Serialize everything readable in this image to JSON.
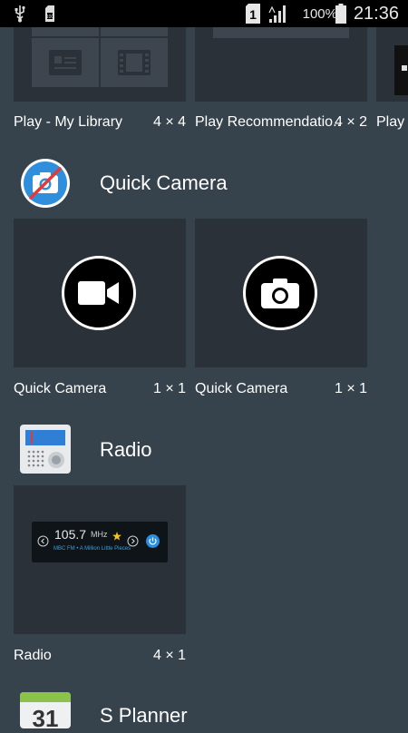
{
  "status_bar": {
    "battery_percent": "100%",
    "time": "21:36",
    "sim_slot": "1",
    "icons": [
      "usb-icon",
      "sd-card-icon",
      "sim-card-icon",
      "signal-icon",
      "battery-icon"
    ]
  },
  "play_section": {
    "widgets": [
      {
        "label": "Play - My Library",
        "size": "4 × 4"
      },
      {
        "label": "Play Recommendatio..",
        "size": "4 × 2"
      },
      {
        "label": "Play S"
      }
    ]
  },
  "quick_camera": {
    "app_name": "Quick Camera",
    "icon": "quick-camera-app-icon",
    "widgets": [
      {
        "label": "Quick Camera",
        "size": "1 × 1",
        "icon": "video-camera-icon"
      },
      {
        "label": "Quick Camera",
        "size": "1 × 1",
        "icon": "photo-camera-icon"
      }
    ]
  },
  "radio": {
    "app_name": "Radio",
    "icon": "radio-app-icon",
    "widgets": [
      {
        "label": "Radio",
        "size": "4 × 1",
        "icon": "radio-widget-preview"
      }
    ],
    "preview": {
      "frequency": "105.7",
      "unit": "MHz",
      "station_line": "MBC FM • A Million Little Pieces"
    }
  },
  "s_planner": {
    "app_name": "S Planner",
    "icon": "calendar-app-icon",
    "day": "31"
  },
  "colors": {
    "background": "#37434c",
    "tile": "#2a3138",
    "accent_blue": "#34a1e6"
  }
}
